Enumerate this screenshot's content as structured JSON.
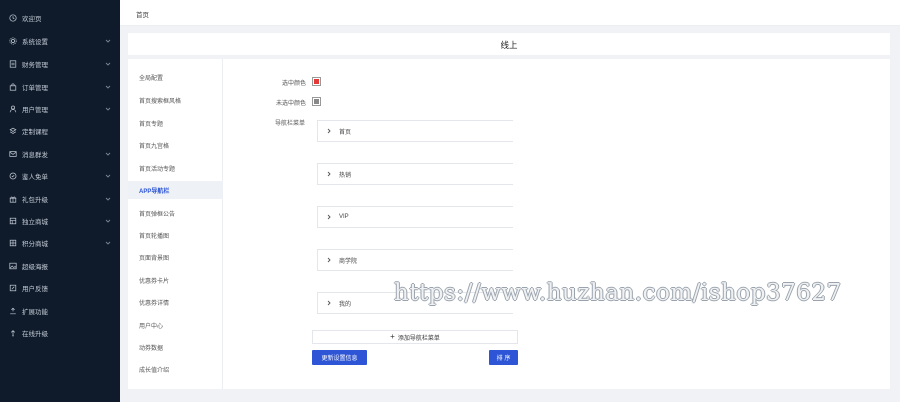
{
  "sidebar": {
    "items": [
      {
        "label": "欢迎页",
        "icon": "clock-icon",
        "has_arrow": false
      },
      {
        "label": "系统设置",
        "icon": "gear-icon",
        "has_arrow": true
      },
      {
        "label": "财务管理",
        "icon": "document-icon",
        "has_arrow": true
      },
      {
        "label": "订单管理",
        "icon": "bag-icon",
        "has_arrow": true
      },
      {
        "label": "用户管理",
        "icon": "user-icon",
        "has_arrow": true
      },
      {
        "label": "定制课程",
        "icon": "layers-icon",
        "has_arrow": false
      },
      {
        "label": "消息群发",
        "icon": "mail-icon",
        "has_arrow": true
      },
      {
        "label": "鉴人免单",
        "icon": "badge-icon",
        "has_arrow": true
      },
      {
        "label": "礼包升级",
        "icon": "gift-icon",
        "has_arrow": true
      },
      {
        "label": "独立商城",
        "icon": "store-icon",
        "has_arrow": true
      },
      {
        "label": "积分商城",
        "icon": "grid-icon",
        "has_arrow": true
      },
      {
        "label": "超级海报",
        "icon": "image-icon",
        "has_arrow": false
      },
      {
        "label": "用户反馈",
        "icon": "edit-icon",
        "has_arrow": false
      },
      {
        "label": "扩展功能",
        "icon": "extend-icon",
        "has_arrow": false
      },
      {
        "label": "在线升级",
        "icon": "upload-icon",
        "has_arrow": false
      }
    ]
  },
  "header": {
    "breadcrumb": "首页"
  },
  "page": {
    "title": "线上"
  },
  "left_nav": {
    "items": [
      {
        "label": "全局配置",
        "active": false
      },
      {
        "label": "首页搜索框风格",
        "active": false
      },
      {
        "label": "首页专题",
        "active": false
      },
      {
        "label": "首页九宫格",
        "active": false
      },
      {
        "label": "首页活动专题",
        "active": false
      },
      {
        "label": "APP导航栏",
        "active": true
      },
      {
        "label": "首页弹框公告",
        "active": false
      },
      {
        "label": "首页轮播图",
        "active": false
      },
      {
        "label": "页面背景图",
        "active": false
      },
      {
        "label": "优惠券卡片",
        "active": false
      },
      {
        "label": "优惠券详情",
        "active": false
      },
      {
        "label": "用户中心",
        "active": false
      },
      {
        "label": "动券数据",
        "active": false
      },
      {
        "label": "成长值介绍",
        "active": false
      }
    ]
  },
  "form": {
    "selected_color_label": "选中颜色",
    "selected_color": "#e53935",
    "unselected_color_label": "未选中颜色",
    "unselected_color": "#888888",
    "nav_menu_label": "导航栏菜单",
    "nav_items": [
      "首页",
      "热销",
      "VIP",
      "商学院",
      "我的"
    ],
    "add_label": "添加导航栏菜单",
    "save_label": "更新设置信息",
    "sort_label": "排 序"
  },
  "watermark": {
    "text": "https://www.huzhan.com/ishop37627"
  },
  "colors": {
    "sidebar_bg": "#0f1b2b",
    "accent": "#2d55d6"
  }
}
